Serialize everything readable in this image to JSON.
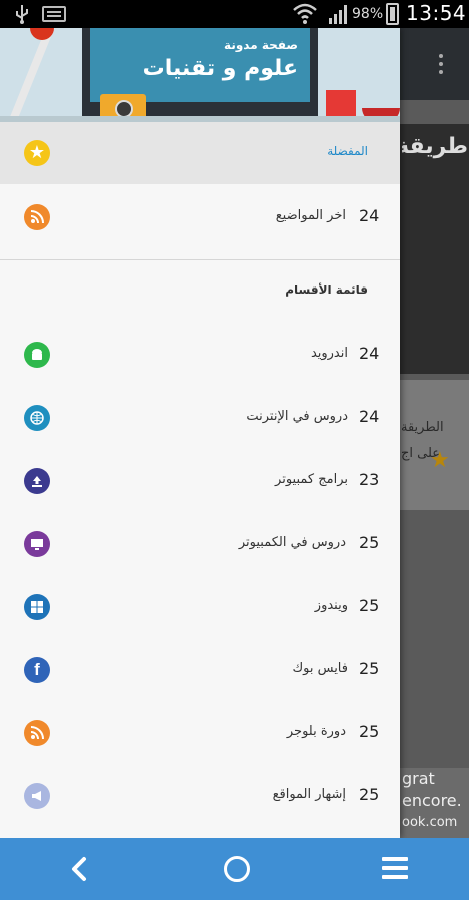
{
  "status_bar": {
    "battery": "98%",
    "time": "13:54",
    "icons": [
      "usb-icon",
      "keyboard-icon",
      "wifi-icon",
      "signal-icon",
      "battery-icon"
    ]
  },
  "background_app": {
    "banner_title": "طريقة",
    "card_line1": "الطريقة",
    "card_line2": "على اج",
    "ad_line1": "grat",
    "ad_line2": "encore.",
    "ad_line3": "ook.com"
  },
  "drawer": {
    "header": {
      "line1": "صفحة مدونة",
      "line2": "علوم و تقنيات"
    },
    "favorites": {
      "label": "المفضلة",
      "icon": "star-icon"
    },
    "latest": {
      "count": "24",
      "label": "اخر المواضيع",
      "icon": "rss-icon"
    },
    "section_title": "قائمة الأقسام",
    "categories": [
      {
        "count": "24",
        "label": "اندرويد",
        "icon": "android-icon"
      },
      {
        "count": "24",
        "label": "دروس في الإنترنت",
        "icon": "globe-icon"
      },
      {
        "count": "23",
        "label": "برامج كمبيوتر",
        "icon": "upload-icon"
      },
      {
        "count": "25",
        "label": "دروس في الكمبيوتر",
        "icon": "monitor-icon"
      },
      {
        "count": "25",
        "label": "ويندوز",
        "icon": "windows-icon"
      },
      {
        "count": "25",
        "label": "فايس بوك",
        "icon": "facebook-icon"
      },
      {
        "count": "25",
        "label": "دورة بلوجر",
        "icon": "rss-icon"
      },
      {
        "count": "25",
        "label": "إشهار المواقع",
        "icon": "megaphone-icon"
      }
    ]
  },
  "navbar": {
    "icons": [
      "back-icon",
      "home-icon",
      "menu-icon"
    ]
  },
  "colors": {
    "nav": "#3f8fd4",
    "favorite_label": "#1e88c8",
    "drawer_bg": "#f7f7f7"
  }
}
